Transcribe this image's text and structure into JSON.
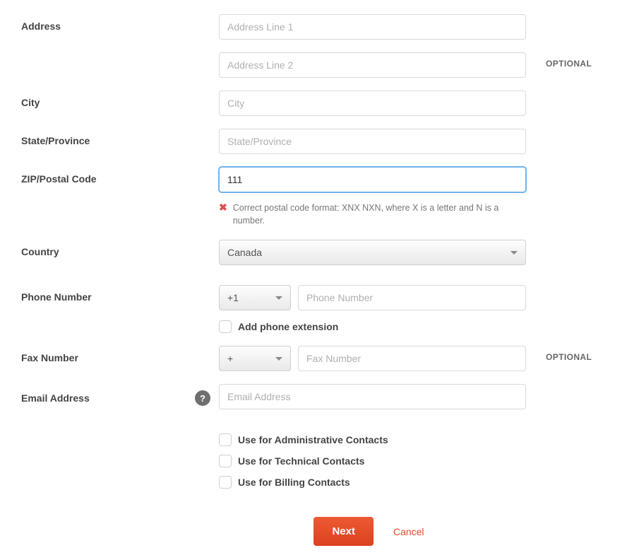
{
  "labels": {
    "address": "Address",
    "city": "City",
    "state": "State/Province",
    "zip": "ZIP/Postal Code",
    "country": "Country",
    "phone": "Phone Number",
    "fax": "Fax Number",
    "email": "Email Address",
    "optional": "OPTIONAL"
  },
  "placeholders": {
    "address1": "Address Line 1",
    "address2": "Address Line 2",
    "city": "City",
    "state": "State/Province",
    "phone": "Phone Number",
    "fax": "Fax Number",
    "email": "Email Address"
  },
  "values": {
    "zip": "111",
    "country": "Canada",
    "phone_cc": "+1",
    "fax_cc": "+"
  },
  "error": {
    "zip": "Correct postal code format: XNX NXN, where X is a letter and N is a number."
  },
  "checkboxes": {
    "add_ext": "Add phone extension",
    "admin": "Use for Administrative Contacts",
    "tech": "Use for Technical Contacts",
    "billing": "Use for Billing Contacts"
  },
  "help_glyph": "?",
  "actions": {
    "next": "Next",
    "cancel": "Cancel"
  }
}
